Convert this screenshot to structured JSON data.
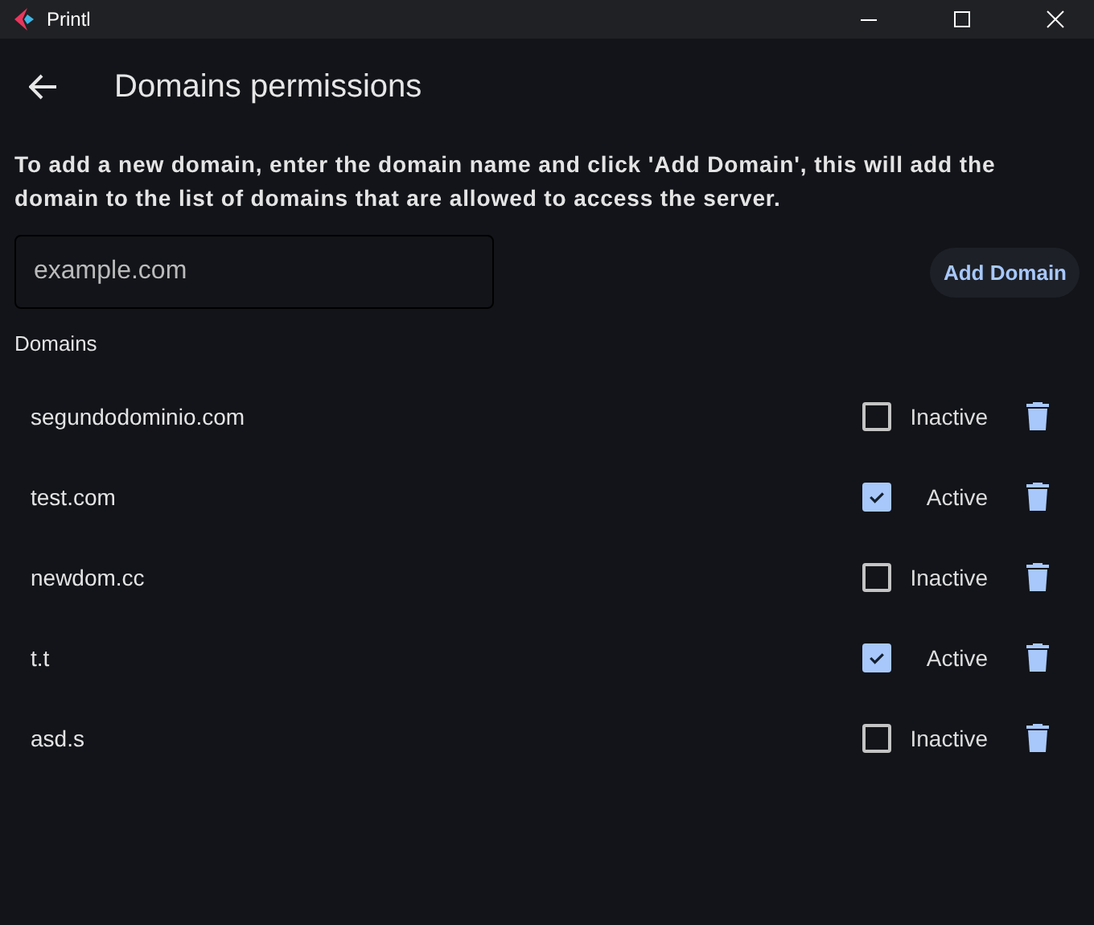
{
  "window": {
    "title": "Printl"
  },
  "page": {
    "title": "Domains permissions"
  },
  "instructions": "To add a new domain, enter the domain name and click 'Add Domain', this will add the domain to the list of domains that are allowed to access the server.",
  "domain_input": {
    "placeholder": "example.com"
  },
  "add_button": "Add Domain",
  "section_label": "Domains",
  "domains": [
    {
      "name": "segundodominio.com",
      "checked": false,
      "status": "Inactive"
    },
    {
      "name": "test.com",
      "checked": true,
      "status": "Active"
    },
    {
      "name": "newdom.cc",
      "checked": false,
      "status": "Inactive"
    },
    {
      "name": "t.t",
      "checked": true,
      "status": "Active"
    },
    {
      "name": "asd.s",
      "checked": false,
      "status": "Inactive"
    }
  ]
}
